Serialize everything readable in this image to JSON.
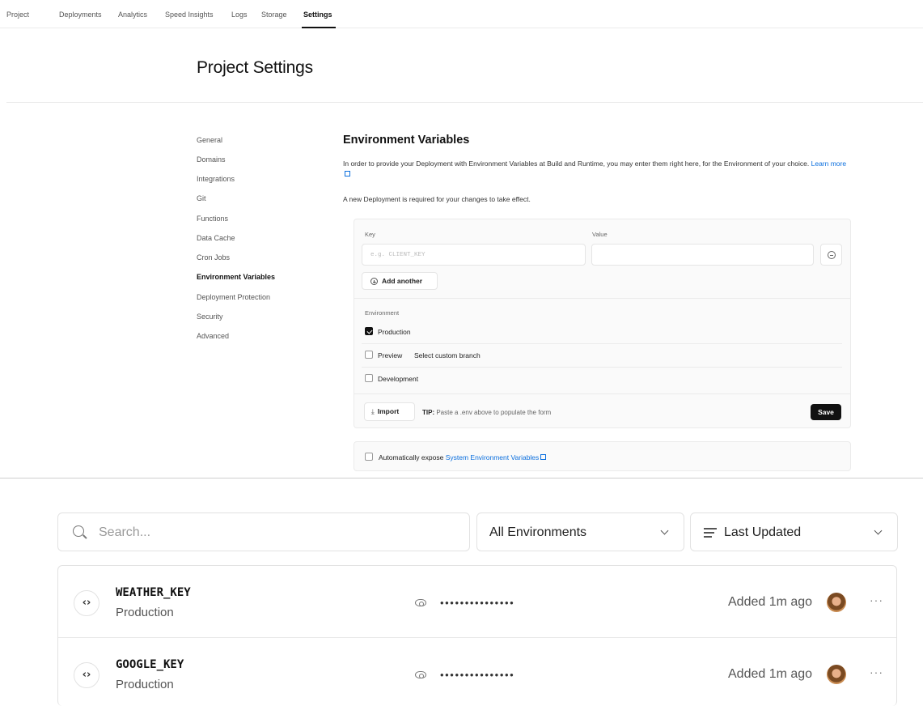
{
  "nav": {
    "tabs": [
      "Project",
      "Deployments",
      "Analytics",
      "Speed Insights",
      "Logs",
      "Storage",
      "Settings"
    ],
    "active": "Settings"
  },
  "page_title": "Project Settings",
  "sidebar": {
    "items": [
      "General",
      "Domains",
      "Integrations",
      "Git",
      "Functions",
      "Data Cache",
      "Cron Jobs",
      "Environment Variables",
      "Deployment Protection",
      "Security",
      "Advanced"
    ],
    "active": "Environment Variables"
  },
  "env": {
    "title": "Environment Variables",
    "description": "In order to provide your Deployment with Environment Variables at Build and Runtime, you may enter them right here, for the Environment of your choice.",
    "learn_more": "Learn more",
    "note": "A new Deployment is required for your changes to take effect.",
    "key_label": "Key",
    "key_placeholder": "e.g. CLIENT_KEY",
    "value_label": "Value",
    "value_value": "",
    "add_another": "Add another",
    "environment_label": "Environment",
    "options": [
      {
        "label": "Production",
        "checked": true
      },
      {
        "label": "Preview",
        "checked": false,
        "link": "Select custom branch"
      },
      {
        "label": "Development",
        "checked": false
      }
    ],
    "import": "Import",
    "tip_label": "TIP:",
    "tip_text": "Paste a .env above to populate the form",
    "save": "Save",
    "auto_expose_text": "Automatically expose",
    "auto_expose_link": "System Environment Variables",
    "auto_expose_checked": false
  },
  "filters": {
    "search_placeholder": "Search...",
    "environment_select": "All Environments",
    "sort_select": "Last Updated"
  },
  "variables": [
    {
      "name": "WEATHER_KEY",
      "environment": "Production",
      "masked": "•••••••••••••••",
      "added": "Added 1m ago",
      "icon": "code-icon"
    },
    {
      "name": "GOOGLE_KEY",
      "environment": "Production",
      "masked": "•••••••••••••••",
      "added": "Added 1m ago",
      "icon": "code-icon"
    }
  ]
}
